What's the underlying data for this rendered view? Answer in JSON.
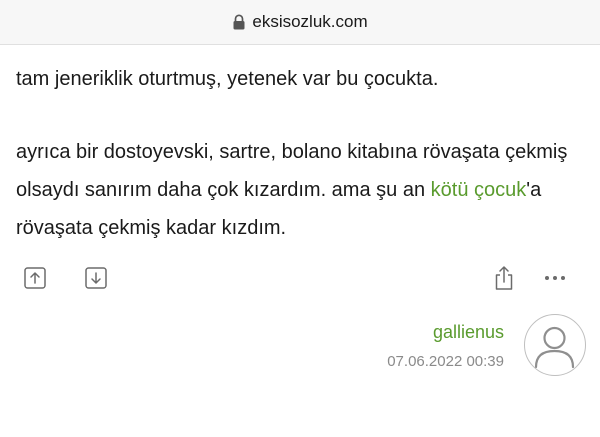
{
  "browser": {
    "url": "eksisozluk.com",
    "lock_icon": "lock-icon"
  },
  "entry": {
    "paragraph1": "tam jeneriklik oturtmuş, yetenek var bu çocukta.",
    "paragraph2_before_link": "ayrıca bir dostoyevski, sartre, bolano kitabına rövaşata çekmiş olsaydı sanırım daha çok kızardım. ama şu an ",
    "paragraph2_link": "kötü çocuk",
    "paragraph2_after_link": "'a rövaşata çekmiş kadar kızdım.",
    "link_color": "#5a9b2e"
  },
  "actions": {
    "upvote_icon": "arrow-up-icon",
    "downvote_icon": "arrow-down-icon",
    "share_icon": "share-icon",
    "more_icon": "more-icon"
  },
  "author": {
    "name": "gallienus",
    "timestamp": "07.06.2022 00:39",
    "avatar_icon": "user-avatar-icon"
  }
}
